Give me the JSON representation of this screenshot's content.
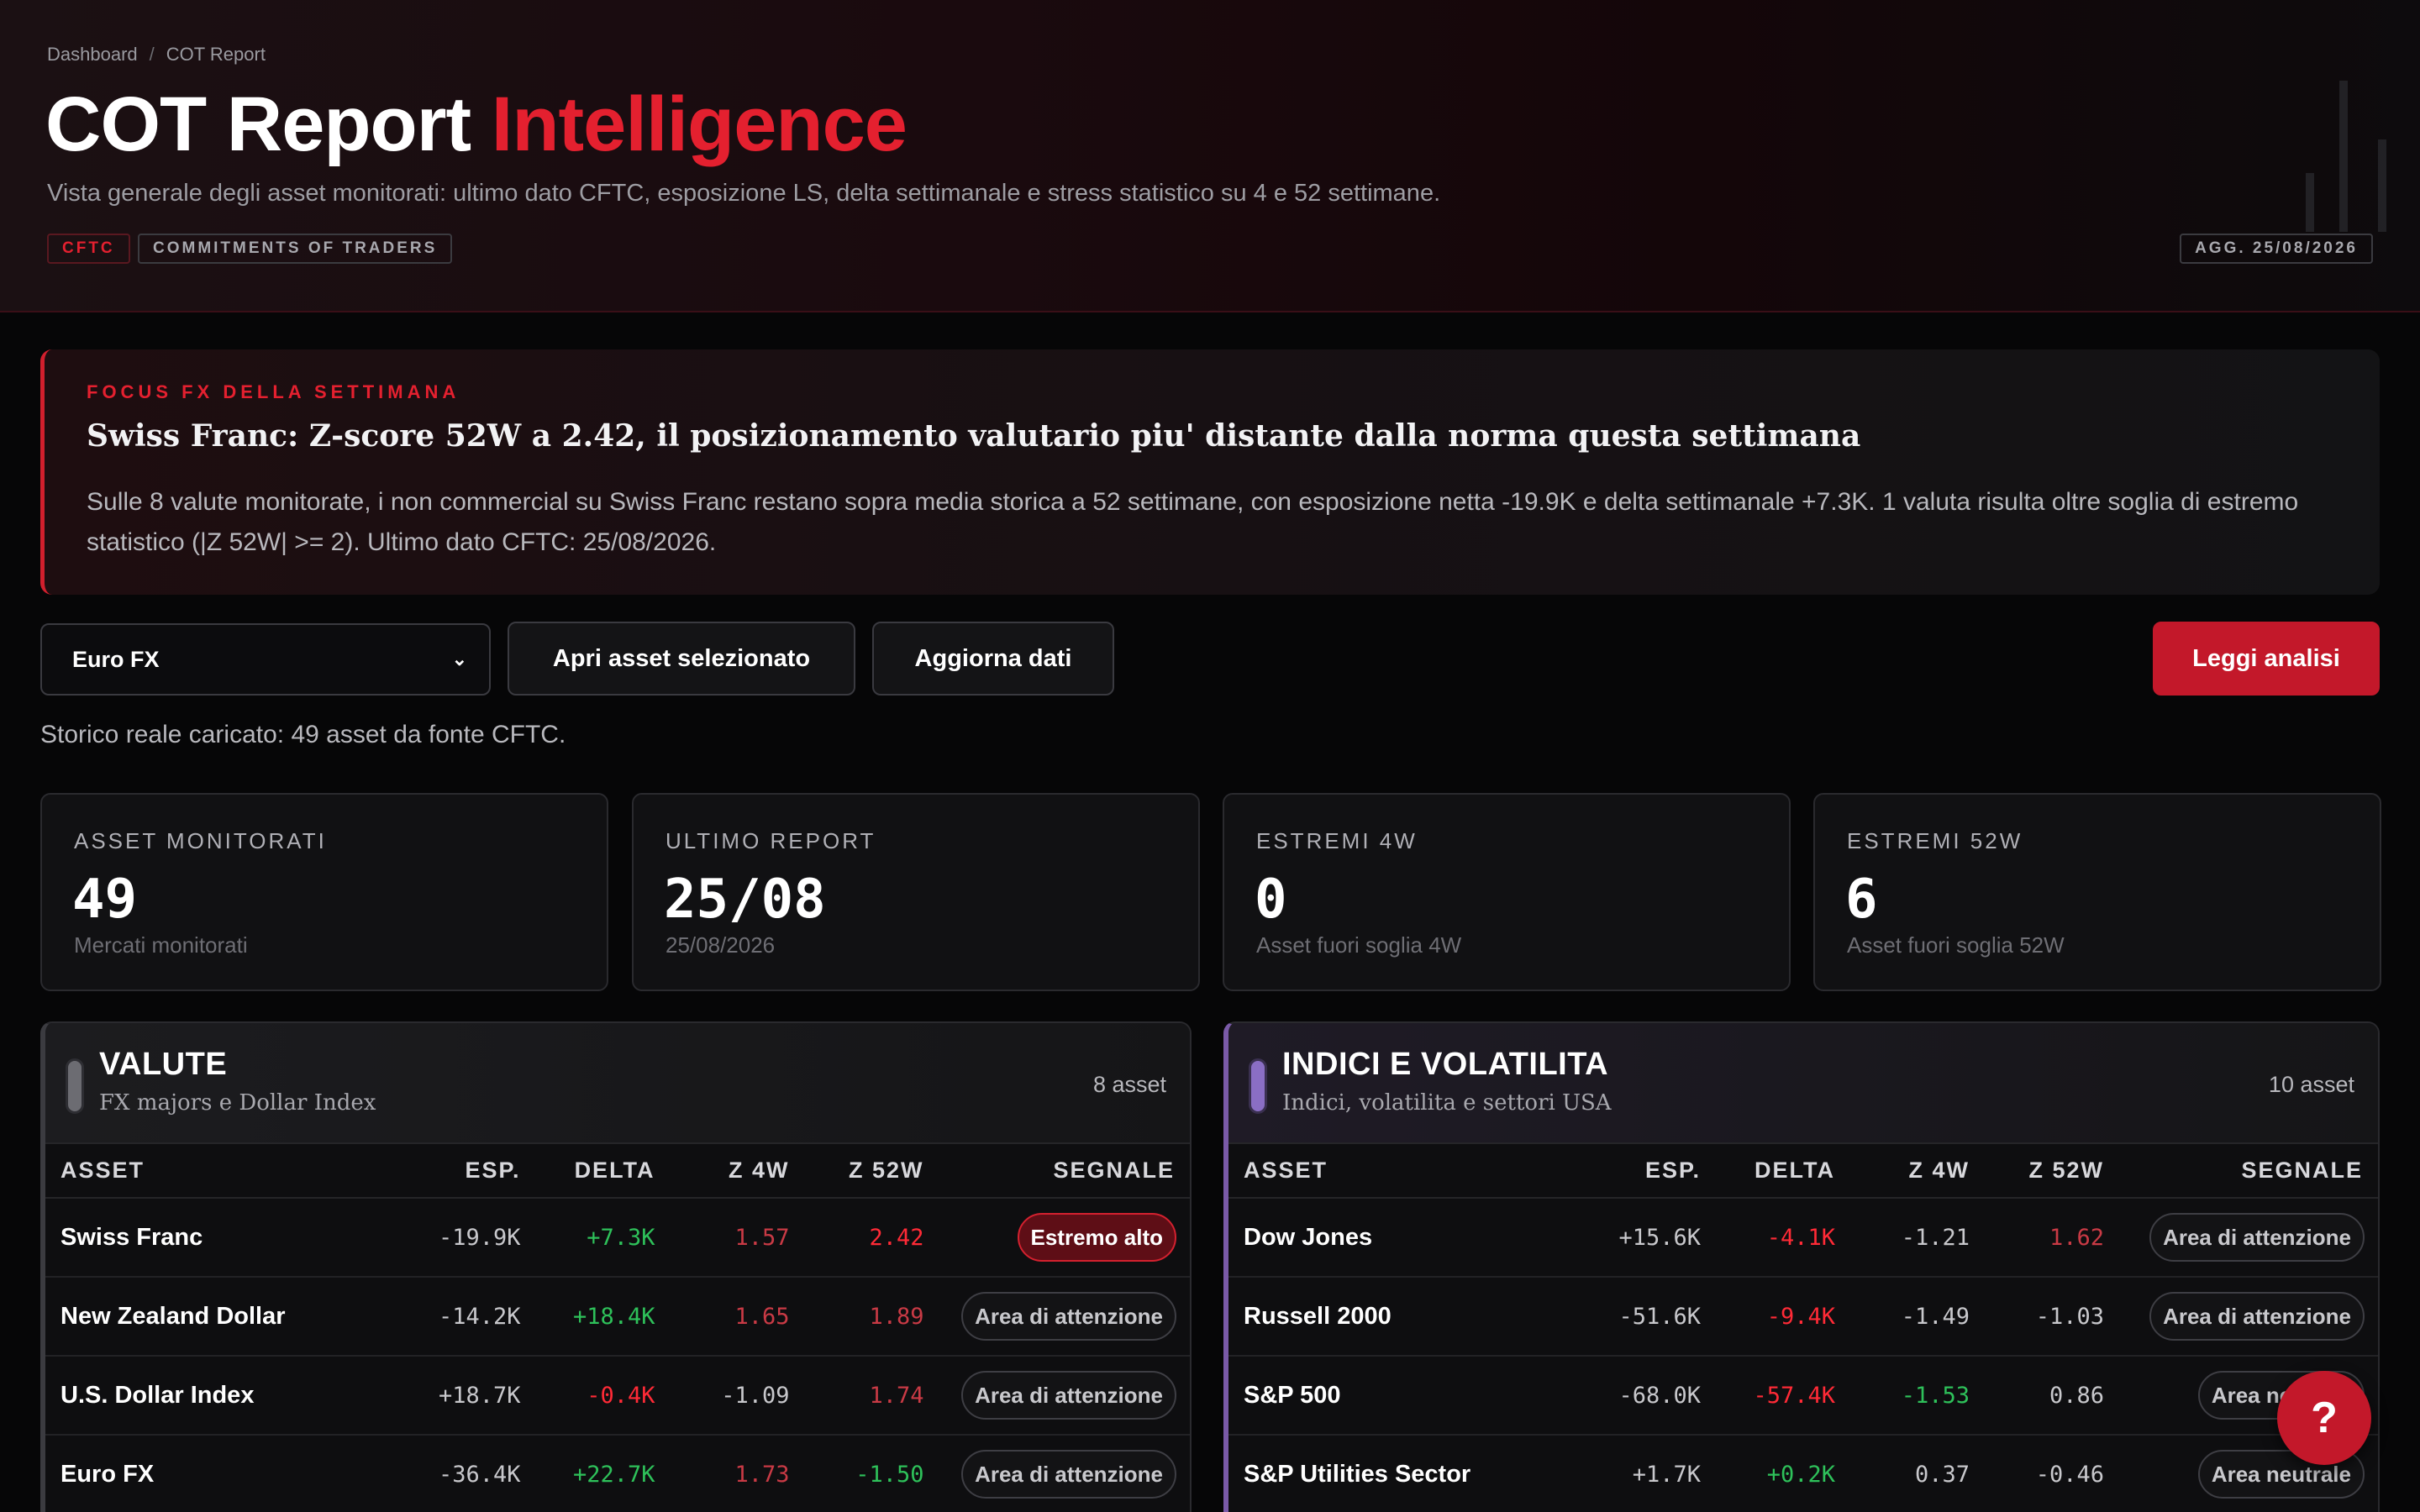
{
  "breadcrumb": {
    "home": "Dashboard",
    "separator": "/",
    "current": "COT Report"
  },
  "header": {
    "title_main": "COT Report",
    "title_accent": "Intelligence",
    "subtitle": "Vista generale degli asset monitorati: ultimo dato CFTC, esposizione LS, delta settimanale e stress statistico su 4 e 52 settimane.",
    "tags": [
      "CFTC",
      "COMMITMENTS OF TRADERS"
    ],
    "updated_tag": "AGG. 25/08/2026"
  },
  "focus": {
    "kicker": "FOCUS FX DELLA SETTIMANA",
    "title": "Swiss Franc: Z-score 52W a 2.42, il posizionamento valutario piu' distante dalla norma questa settimana",
    "body": "Sulle 8 valute monitorate, i non commercial su Swiss Franc restano sopra media storica a 52 settimane, con esposizione netta -19.9K e delta settimanale +7.3K. 1 valuta risulta oltre soglia di estremo statistico (|Z 52W| >= 2). Ultimo dato CFTC: 25/08/2026."
  },
  "controls": {
    "asset_select": "Euro FX",
    "open_button": "Apri asset selezionato",
    "refresh_button": "Aggiorna dati",
    "read_button": "Leggi analisi",
    "status": "Storico reale caricato: 49 asset da fonte CFTC."
  },
  "kpis": [
    {
      "label": "ASSET MONITORATI",
      "value": "49",
      "sub": "Mercati monitorati"
    },
    {
      "label": "ULTIMO REPORT",
      "value": "25/08",
      "sub": "25/08/2026"
    },
    {
      "label": "ESTREMI 4W",
      "value": "0",
      "sub": "Asset fuori soglia 4W"
    },
    {
      "label": "ESTREMI 52W",
      "value": "6",
      "sub": "Asset fuori soglia 52W"
    }
  ],
  "columns": [
    "ASSET",
    "ESP.",
    "DELTA",
    "Z 4W",
    "Z 52W",
    "SEGNALE"
  ],
  "panels": [
    {
      "title": "VALUTE",
      "subtitle": "FX majors e Dollar Index",
      "count": "8 asset",
      "rows": [
        {
          "asset": "Swiss Franc",
          "esp": "-19.9K",
          "delta": "+7.3K",
          "z4": "1.57",
          "z52": "2.42",
          "signal": "Estremo alto",
          "hot": true,
          "delta_cls": "pos",
          "z4_cls": "warn",
          "z52_cls": "neg"
        },
        {
          "asset": "New Zealand Dollar",
          "esp": "-14.2K",
          "delta": "+18.4K",
          "z4": "1.65",
          "z52": "1.89",
          "signal": "Area di attenzione",
          "hot": false,
          "delta_cls": "pos",
          "z4_cls": "warn",
          "z52_cls": "warn"
        },
        {
          "asset": "U.S. Dollar Index",
          "esp": "+18.7K",
          "delta": "-0.4K",
          "z4": "-1.09",
          "z52": "1.74",
          "signal": "Area di attenzione",
          "hot": false,
          "delta_cls": "neg",
          "z4_cls": "neu",
          "z52_cls": "warn"
        },
        {
          "asset": "Euro FX",
          "esp": "-36.4K",
          "delta": "+22.7K",
          "z4": "1.73",
          "z52": "-1.50",
          "signal": "Area di attenzione",
          "hot": false,
          "delta_cls": "pos",
          "z4_cls": "warn",
          "z52_cls": "pos"
        }
      ]
    },
    {
      "title": "INDICI E VOLATILITA",
      "subtitle": "Indici, volatilita e settori USA",
      "count": "10 asset",
      "rows": [
        {
          "asset": "Dow Jones",
          "esp": "+15.6K",
          "delta": "-4.1K",
          "z4": "-1.21",
          "z52": "1.62",
          "signal": "Area di attenzione",
          "hot": false,
          "delta_cls": "neg",
          "z4_cls": "neu",
          "z52_cls": "warn"
        },
        {
          "asset": "Russell 2000",
          "esp": "-51.6K",
          "delta": "-9.4K",
          "z4": "-1.49",
          "z52": "-1.03",
          "signal": "Area di attenzione",
          "hot": false,
          "delta_cls": "neg",
          "z4_cls": "neu",
          "z52_cls": "neu"
        },
        {
          "asset": "S&P 500",
          "esp": "-68.0K",
          "delta": "-57.4K",
          "z4": "-1.53",
          "z52": "0.86",
          "signal": "Area neutrale",
          "hot": false,
          "delta_cls": "neg",
          "z4_cls": "pos",
          "z52_cls": "neu"
        },
        {
          "asset": "S&P Utilities Sector",
          "esp": "+1.7K",
          "delta": "+0.2K",
          "z4": "0.37",
          "z52": "-0.46",
          "signal": "Area neutrale",
          "hot": false,
          "delta_cls": "pos",
          "z4_cls": "neu",
          "z52_cls": "neu"
        }
      ]
    }
  ],
  "help_label": "?",
  "colors": {
    "accent": "#e4202f",
    "positive": "#2ec15a",
    "negative": "#ff2a36",
    "fx_panel": "#3b3b40",
    "index_panel": "#7a5aa8"
  }
}
